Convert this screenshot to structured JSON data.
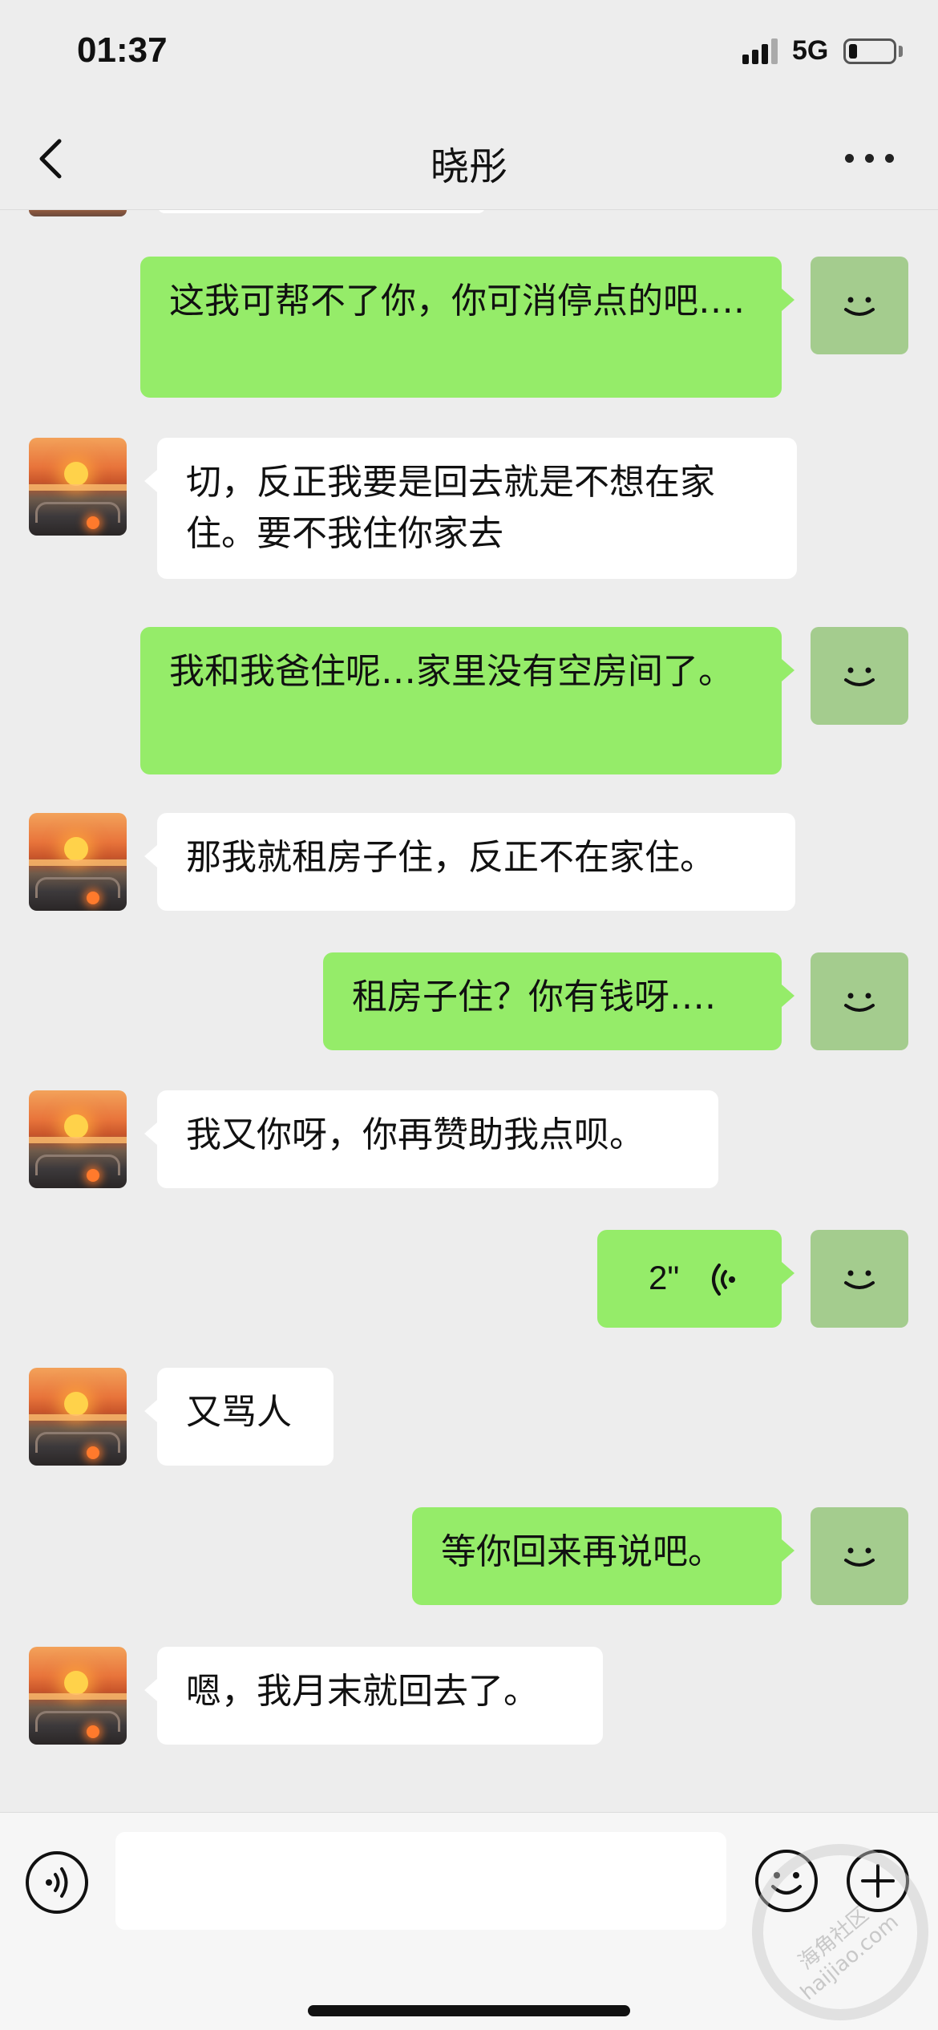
{
  "status_bar": {
    "time": "01:37",
    "network": "5G",
    "battery_level": 0.18
  },
  "nav": {
    "title": "晓彤",
    "back_icon": "chevron-left-icon",
    "more_icon": "more-dots-icon"
  },
  "messages": [
    {
      "from": "self",
      "text": "这我可帮不了你，你可消停点的吧…."
    },
    {
      "from": "other",
      "text": "切，反正我要是回去就是不想在家住。要不我住你家去"
    },
    {
      "from": "self",
      "text": "我和我爸住呢…家里没有空房间了。"
    },
    {
      "from": "other",
      "text": "那我就租房子住，反正不在家住。"
    },
    {
      "from": "self",
      "text": "租房子住？你有钱呀…."
    },
    {
      "from": "other",
      "text": "我又你呀，你再赞助我点呗。"
    },
    {
      "from": "self",
      "type": "voice",
      "duration": "2\""
    },
    {
      "from": "other",
      "text": "又骂人"
    },
    {
      "from": "self",
      "text": "等你回来再说吧。"
    },
    {
      "from": "other",
      "text": "嗯，我月末就回去了。"
    }
  ],
  "input_bar": {
    "voice_icon": "voice-input-icon",
    "emoji_icon": "emoji-icon",
    "plus_icon": "plus-icon",
    "text_value": ""
  },
  "colors": {
    "self_bubble": "#95EC69",
    "other_bubble": "#FFFFFF",
    "background": "#EDEDED",
    "self_avatar": "#A4CC8E"
  },
  "watermark_text": "海角社区 haijiao.com"
}
